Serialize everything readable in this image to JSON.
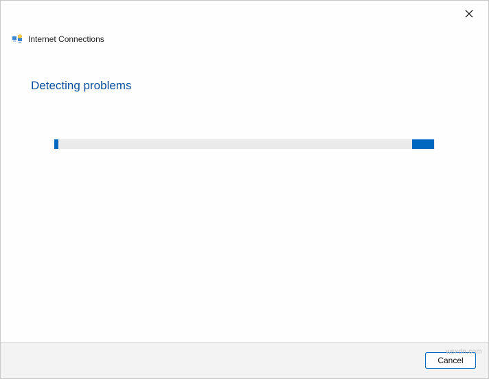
{
  "window": {
    "title": "Internet Connections"
  },
  "page": {
    "heading": "Detecting problems"
  },
  "progress": {
    "indeterminate": true
  },
  "footer": {
    "cancel_label": "Cancel"
  },
  "watermark": "wsxdn.com",
  "colors": {
    "accent": "#0067c0",
    "heading": "#0a4f9e"
  }
}
